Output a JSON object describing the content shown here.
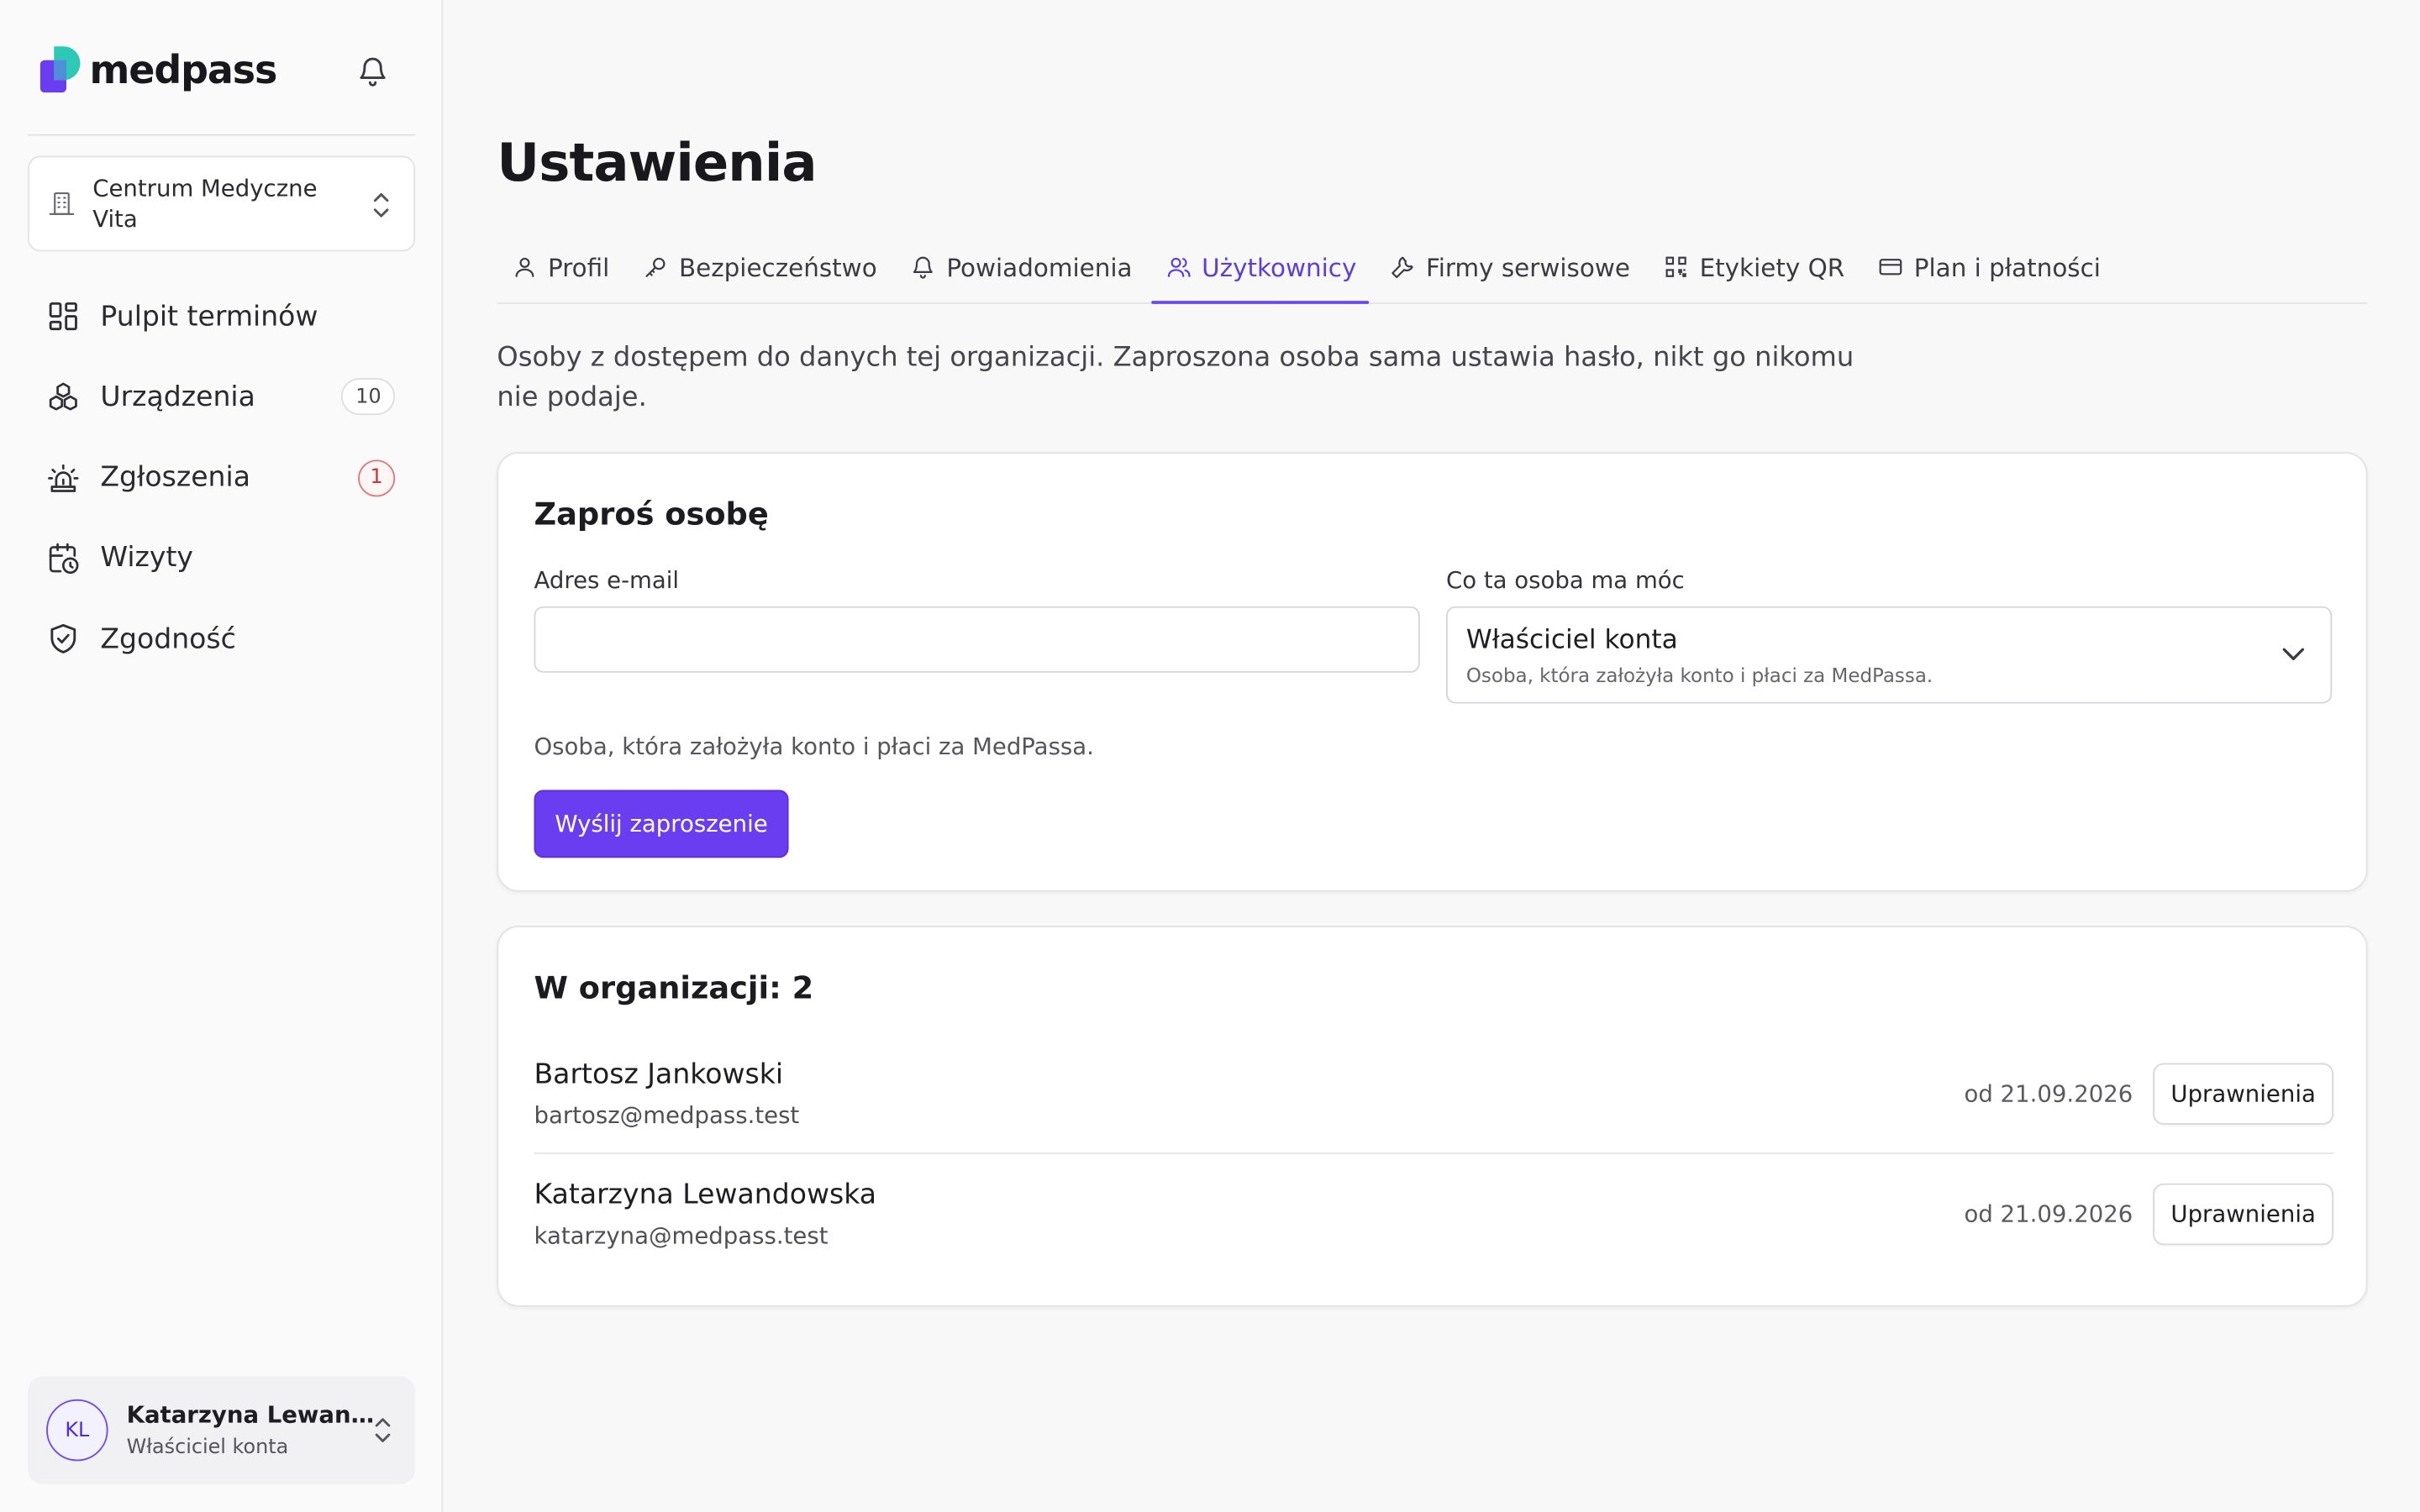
{
  "app": {
    "brand_name": "medpass",
    "brand_colors": {
      "purple": "#6a3ef0",
      "teal": "#2ec9b6"
    }
  },
  "sidebar": {
    "organization": "Centrum Medyczne Vita",
    "nav": [
      {
        "label": "Pulpit terminów",
        "icon": "dashboard-grid-icon"
      },
      {
        "label": "Urządzenia",
        "icon": "devices-icon",
        "badge": "10"
      },
      {
        "label": "Zgłoszenia",
        "icon": "siren-icon",
        "badge": "1"
      },
      {
        "label": "Wizyty",
        "icon": "calendar-clock-icon"
      },
      {
        "label": "Zgodność",
        "icon": "shield-check-icon"
      }
    ],
    "user": {
      "initials": "KL",
      "name": "Katarzyna Lewan…",
      "role": "Właściciel konta"
    }
  },
  "main": {
    "title": "Ustawienia",
    "tabs": [
      {
        "label": "Profil",
        "icon": "user-icon",
        "active": false
      },
      {
        "label": "Bezpieczeństwo",
        "icon": "key-icon",
        "active": false
      },
      {
        "label": "Powiadomienia",
        "icon": "bell-icon",
        "active": false
      },
      {
        "label": "Użytkownicy",
        "icon": "users-icon",
        "active": true
      },
      {
        "label": "Firmy serwisowe",
        "icon": "wrench-icon",
        "active": false
      },
      {
        "label": "Etykiety QR",
        "icon": "qr-code-icon",
        "active": false
      },
      {
        "label": "Plan i płatności",
        "icon": "credit-card-icon",
        "active": false
      }
    ],
    "intro": "Osoby z dostępem do danych tej organizacji. Zaproszona osoba sama ustawia hasło, nikt go nikomu nie podaje.",
    "invite": {
      "title": "Zaproś osobę",
      "email_label": "Adres e-mail",
      "email_value": "",
      "role_label": "Co ta osoba ma móc",
      "role_selected": "Właściciel konta",
      "role_selected_desc": "Osoba, która założyła konto i płaci za MedPassa.",
      "role_help": "Osoba, która założyła konto i płaci za MedPassa.",
      "submit_label": "Wyślij zaproszenie"
    },
    "members": {
      "title": "W organizacji: 2",
      "rows": [
        {
          "name": "Bartosz Jankowski",
          "email": "bartosz@medpass.test",
          "since": "od 21.09.2026",
          "action": "Uprawnienia"
        },
        {
          "name": "Katarzyna Lewandowska",
          "email": "katarzyna@medpass.test",
          "since": "od 21.09.2026",
          "action": "Uprawnienia"
        }
      ]
    }
  }
}
